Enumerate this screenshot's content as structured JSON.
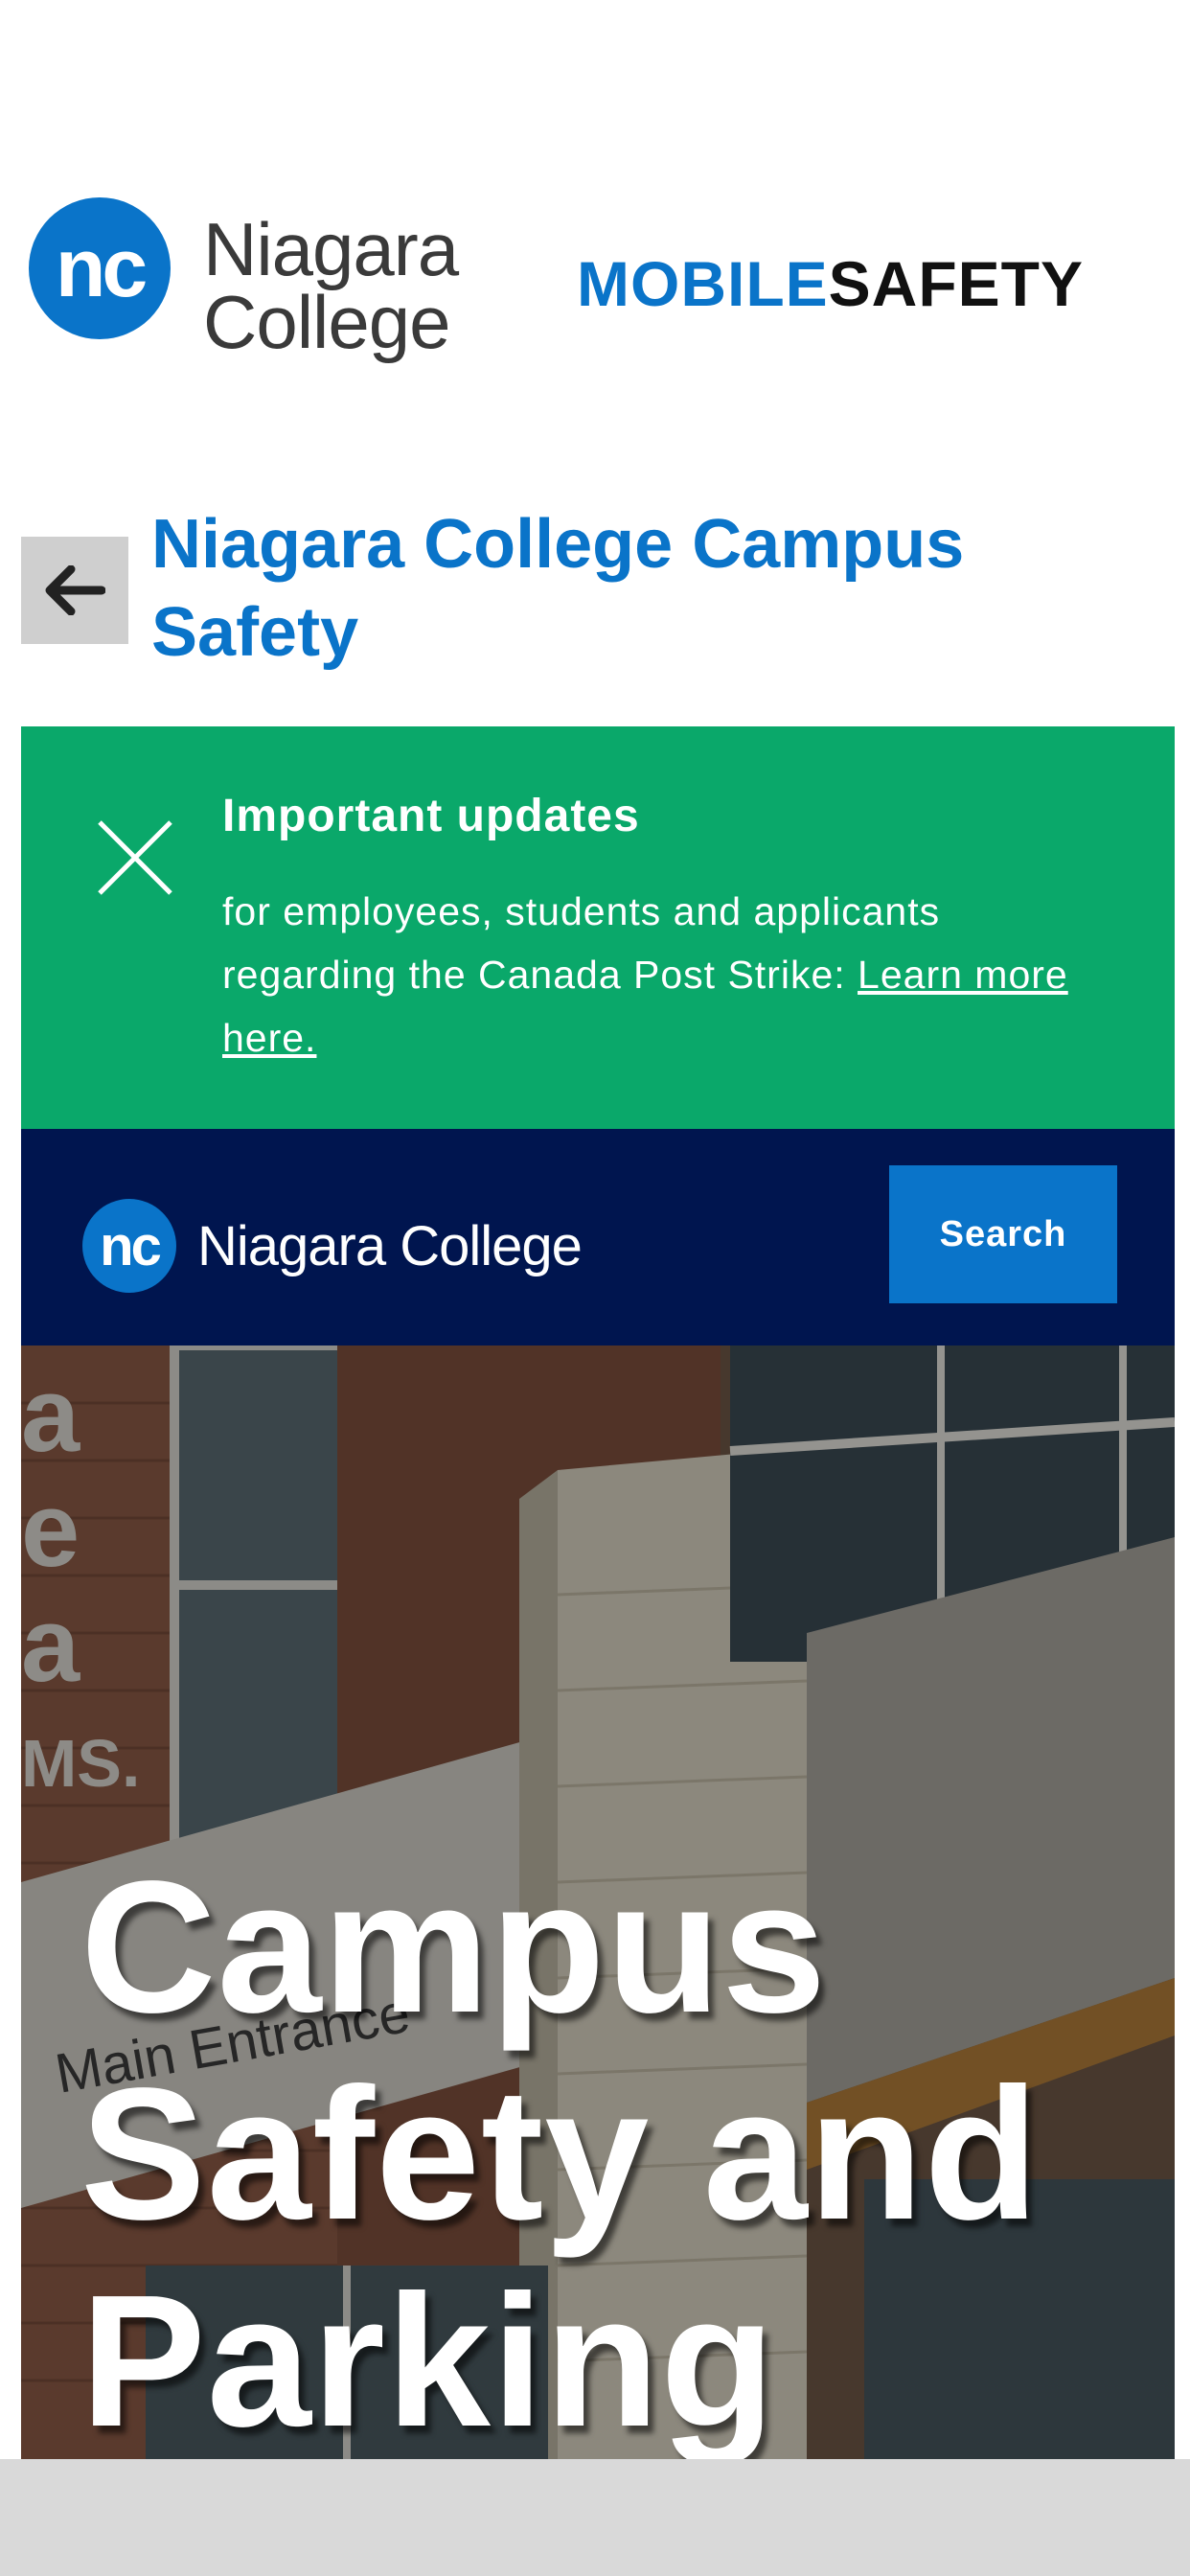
{
  "header": {
    "logo_mark": "nc",
    "logo_line1": "Niagara",
    "logo_line2": "College",
    "brand_part1": "MOBILE",
    "brand_part2": "SAFETY"
  },
  "page": {
    "title": "Niagara College Campus Safety",
    "back_icon": "arrow-left-icon"
  },
  "alert": {
    "title": "Important updates",
    "body": "for employees, students and applicants regarding the Canada Post Strike: ",
    "link_text": "Learn more here.",
    "close_icon": "close-icon",
    "background": "#0aa86a"
  },
  "site_nav": {
    "logo_mark": "nc",
    "logo_text": "Niagara College",
    "search_label": "Search",
    "background": "#00154f"
  },
  "hero": {
    "title": "Campus Safety and Parking"
  },
  "colors": {
    "accent": "#0a74c9",
    "alert_green": "#0aa86a",
    "navy": "#00154f"
  }
}
